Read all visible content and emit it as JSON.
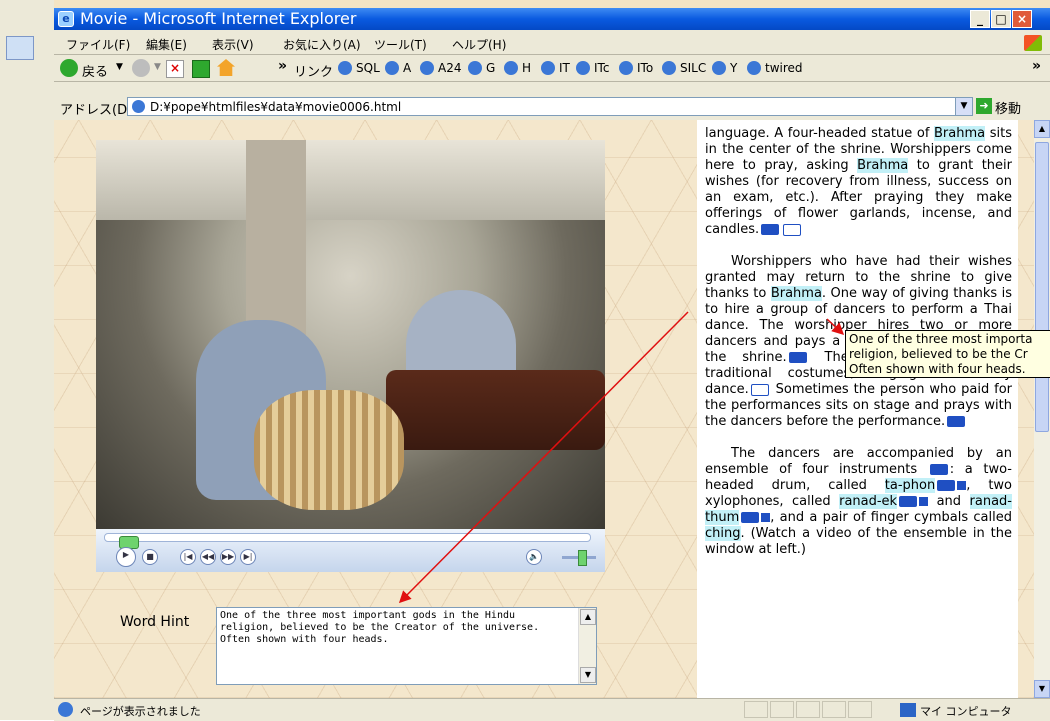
{
  "window": {
    "title": "Movie - Microsoft Internet Explorer",
    "minimize": "_",
    "maximize": "□",
    "close": "×"
  },
  "menu": [
    "ファイル(F)",
    "編集(E)",
    "表示(V)",
    "お気に入り(A)",
    "ツール(T)",
    "ヘルプ(H)"
  ],
  "toolbar": {
    "back_label": "戻る",
    "chevron": "»",
    "links_label": "リンク",
    "links": [
      "SQL",
      "A",
      "A24",
      "G",
      "H",
      "IT",
      "ITc",
      "ITo",
      "SILC",
      "Y",
      "twired"
    ]
  },
  "address": {
    "label": "アドレス(D)",
    "url": "D:¥pope¥htmlfiles¥data¥movie0006.html",
    "go_label": "移動"
  },
  "player": {
    "controls": [
      "▶",
      "■",
      "|◀",
      "◀◀",
      "▶▶",
      "▶|"
    ],
    "volume_icon": "🔈",
    "progress": 0.03,
    "volume": 0.6
  },
  "hint": {
    "label": "Word Hint",
    "text": "One of the three most important gods in the Hindu religion, believed to be the Creator of the universe. Often shown with four heads."
  },
  "article": {
    "p1_a": "language. A four-headed statue of ",
    "p1_k1": "Brahma",
    "p1_b": " sits in the center of the shrine. Worshippers come here to pray, asking ",
    "p1_k2": "Brahma",
    "p1_c": " to grant their wishes (for recovery from illness, success on an exam, etc.). After praying they make offerings of flower garlands, incense, and candles.",
    "p2_a": "Worshippers who have had their wishes granted may return to the shrine to give thanks to ",
    "p2_k1": "Brahma",
    "p2_b": ". One way of giving thanks is to hire a group of dancers to perform a Thai dance. The worshipper hires two or more dancers and pays a fixed price at a table at the shrine.",
    "p2_c": " The dancers perform in traditional costumes, singing while they dance.",
    "p2_d": " Sometimes the person who paid for the performances sits on stage and prays with the dancers before the performance.",
    "p3_a": "The dancers are accompanied by an ensemble of four instruments ",
    "p3_b": ": a two-headed drum, called ",
    "p3_k1": "ta-phon",
    "p3_c": ", two xylophones, called ",
    "p3_k2": "ranad-ek",
    "p3_d": " and ",
    "p3_k3": "ranad-thum",
    "p3_e": ", and a pair of finger cymbals called ",
    "p3_k4": "ching",
    "p3_f": ". (Watch a video of the ensemble in the window at left.)"
  },
  "tooltip": {
    "line1": "One of the three most importa",
    "line2": "religion, believed to be the Cr",
    "line3": "Often shown with four heads."
  },
  "status": {
    "text": "ページが表示されました",
    "zone": "マイ コンピュータ"
  },
  "colors": {
    "titlebar": "#0a5ae0",
    "keyword_highlight": "#c2f0f7",
    "arrow": "#e01010",
    "tooltip_bg": "#ffffe1"
  }
}
